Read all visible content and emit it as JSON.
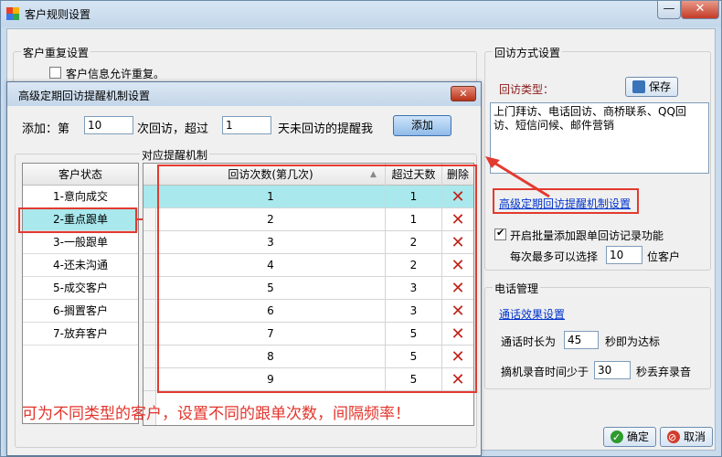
{
  "window": {
    "title": "客户规则设置",
    "close_glyph": "✕",
    "minimize_glyph": "—"
  },
  "dup_group": {
    "label": "客户重复设置",
    "allow_dup_label": "客户信息允许重复。"
  },
  "dialog": {
    "title": "高级定期回访提醒机制设置",
    "close_glyph": "✕",
    "add_prefix": "添加：第",
    "add_times_value": "10",
    "add_middle": "次回访，超过",
    "add_days_value": "1",
    "add_suffix": "天未回访的提醒我",
    "add_button": "添加",
    "mech_group_label": "对应提醒机制",
    "status_header": "客户状态",
    "statuses": [
      "1-意向成交",
      "2-重点跟单",
      "3-一般跟单",
      "4-还未沟通",
      "5-成交客户",
      "6-搁置客户",
      "7-放弃客户"
    ],
    "selected_status_index": 1,
    "columns": {
      "times": "回访次数(第几次)",
      "days": "超过天数",
      "del": "删除"
    },
    "rows": [
      {
        "times": "1",
        "days": "1"
      },
      {
        "times": "2",
        "days": "1"
      },
      {
        "times": "3",
        "days": "2"
      },
      {
        "times": "4",
        "days": "2"
      },
      {
        "times": "5",
        "days": "3"
      },
      {
        "times": "6",
        "days": "3"
      },
      {
        "times": "7",
        "days": "5"
      },
      {
        "times": "8",
        "days": "5"
      },
      {
        "times": "9",
        "days": "5"
      }
    ],
    "annotation": "可为不同类型的客户，设置不同的跟单次数，间隔频率！"
  },
  "visit_group": {
    "label": "回访方式设置",
    "type_label": "回访类型：",
    "save_button": "保存",
    "types_text": "上门拜访、电话回访、商桥联系、QQ回访、短信问候、邮件营销",
    "advanced_link": "高级定期回访提醒机制设置",
    "batch_label": "开启批量添加跟单回访记录功能",
    "batch_checked": true,
    "max_prefix": "每次最多可以选择",
    "max_value": "10",
    "max_suffix": "位客户"
  },
  "phone_group": {
    "label": "电话管理",
    "effect_link": "通话效果设置",
    "duration_prefix": "通话时长为",
    "duration_value": "45",
    "duration_suffix": "秒即为达标",
    "record_prefix": "摘机录音时间少于",
    "record_value": "30",
    "record_suffix": "秒丢弃录音"
  },
  "footer": {
    "ok_button": "确定",
    "cancel_button": "取消"
  },
  "colors": {
    "highlight_red": "#e33a2f",
    "selected_row": "#a9e8ec",
    "link_blue": "#0033cc"
  }
}
